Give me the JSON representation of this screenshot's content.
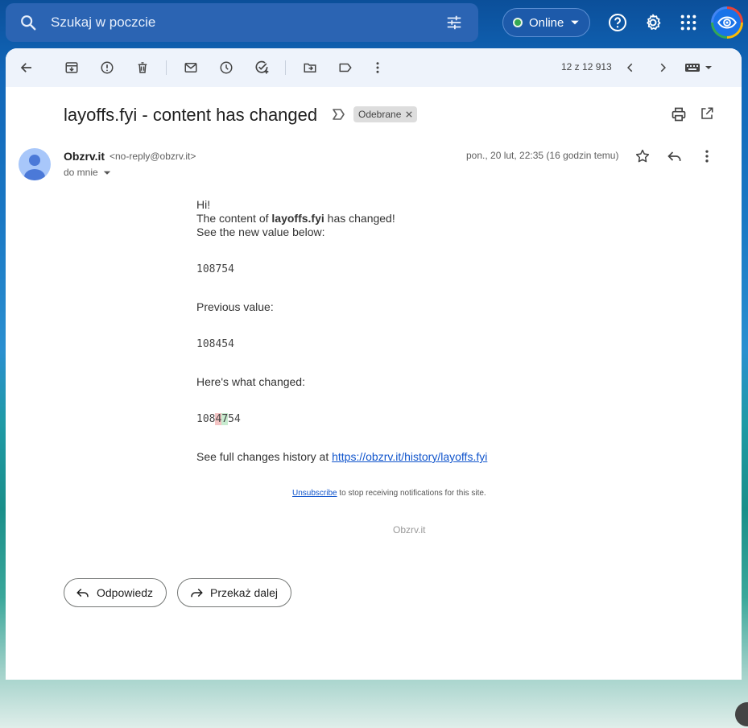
{
  "search": {
    "placeholder": "Szukaj w poczcie"
  },
  "status": {
    "label": "Online",
    "color": "#34a853"
  },
  "toolbar": {
    "icons": [
      "back-arrow-icon",
      "archive-icon",
      "report-spam-icon",
      "delete-icon",
      "mark-unread-icon",
      "snooze-icon",
      "add-task-icon",
      "move-to-icon",
      "label-icon",
      "more-vert-icon"
    ],
    "pager": "12 z 12 913"
  },
  "email": {
    "subject": "layoffs.fyi - content has changed",
    "label_chip": "Odebrane",
    "sender_name": "Obzrv.it",
    "sender_email": "<no-reply@obzrv.it>",
    "recipient": "do mnie",
    "date": "pon., 20 lut, 22:35 (16 godzin temu)"
  },
  "body": {
    "greeting": "Hi!",
    "line2_prefix": "The content of ",
    "line2_site": "layoffs.fyi",
    "line2_suffix": " has changed!",
    "line3": "See the new value below:",
    "new_value": "108754",
    "previous_label": "Previous value:",
    "previous_value": "108454",
    "changed_label": "Here's what changed:",
    "diff_prefix": "108",
    "diff_removed": "4",
    "diff_added": "7",
    "diff_suffix": "54",
    "history_prefix": "See full changes history at ",
    "history_link": "https://obzrv.it/history/layoffs.fyi",
    "unsubscribe_link": "Unsubscribe",
    "unsubscribe_text": " to stop receiving notifications for this site.",
    "brand": "Obzrv.it"
  },
  "actions": {
    "reply": "Odpowiedz",
    "forward": "Przekaż dalej"
  },
  "colors": {
    "accent": "#1a73e8",
    "link": "#1155cc",
    "diff_removed_bg": "#f4c4c4",
    "diff_added_bg": "#c8ecd0"
  }
}
